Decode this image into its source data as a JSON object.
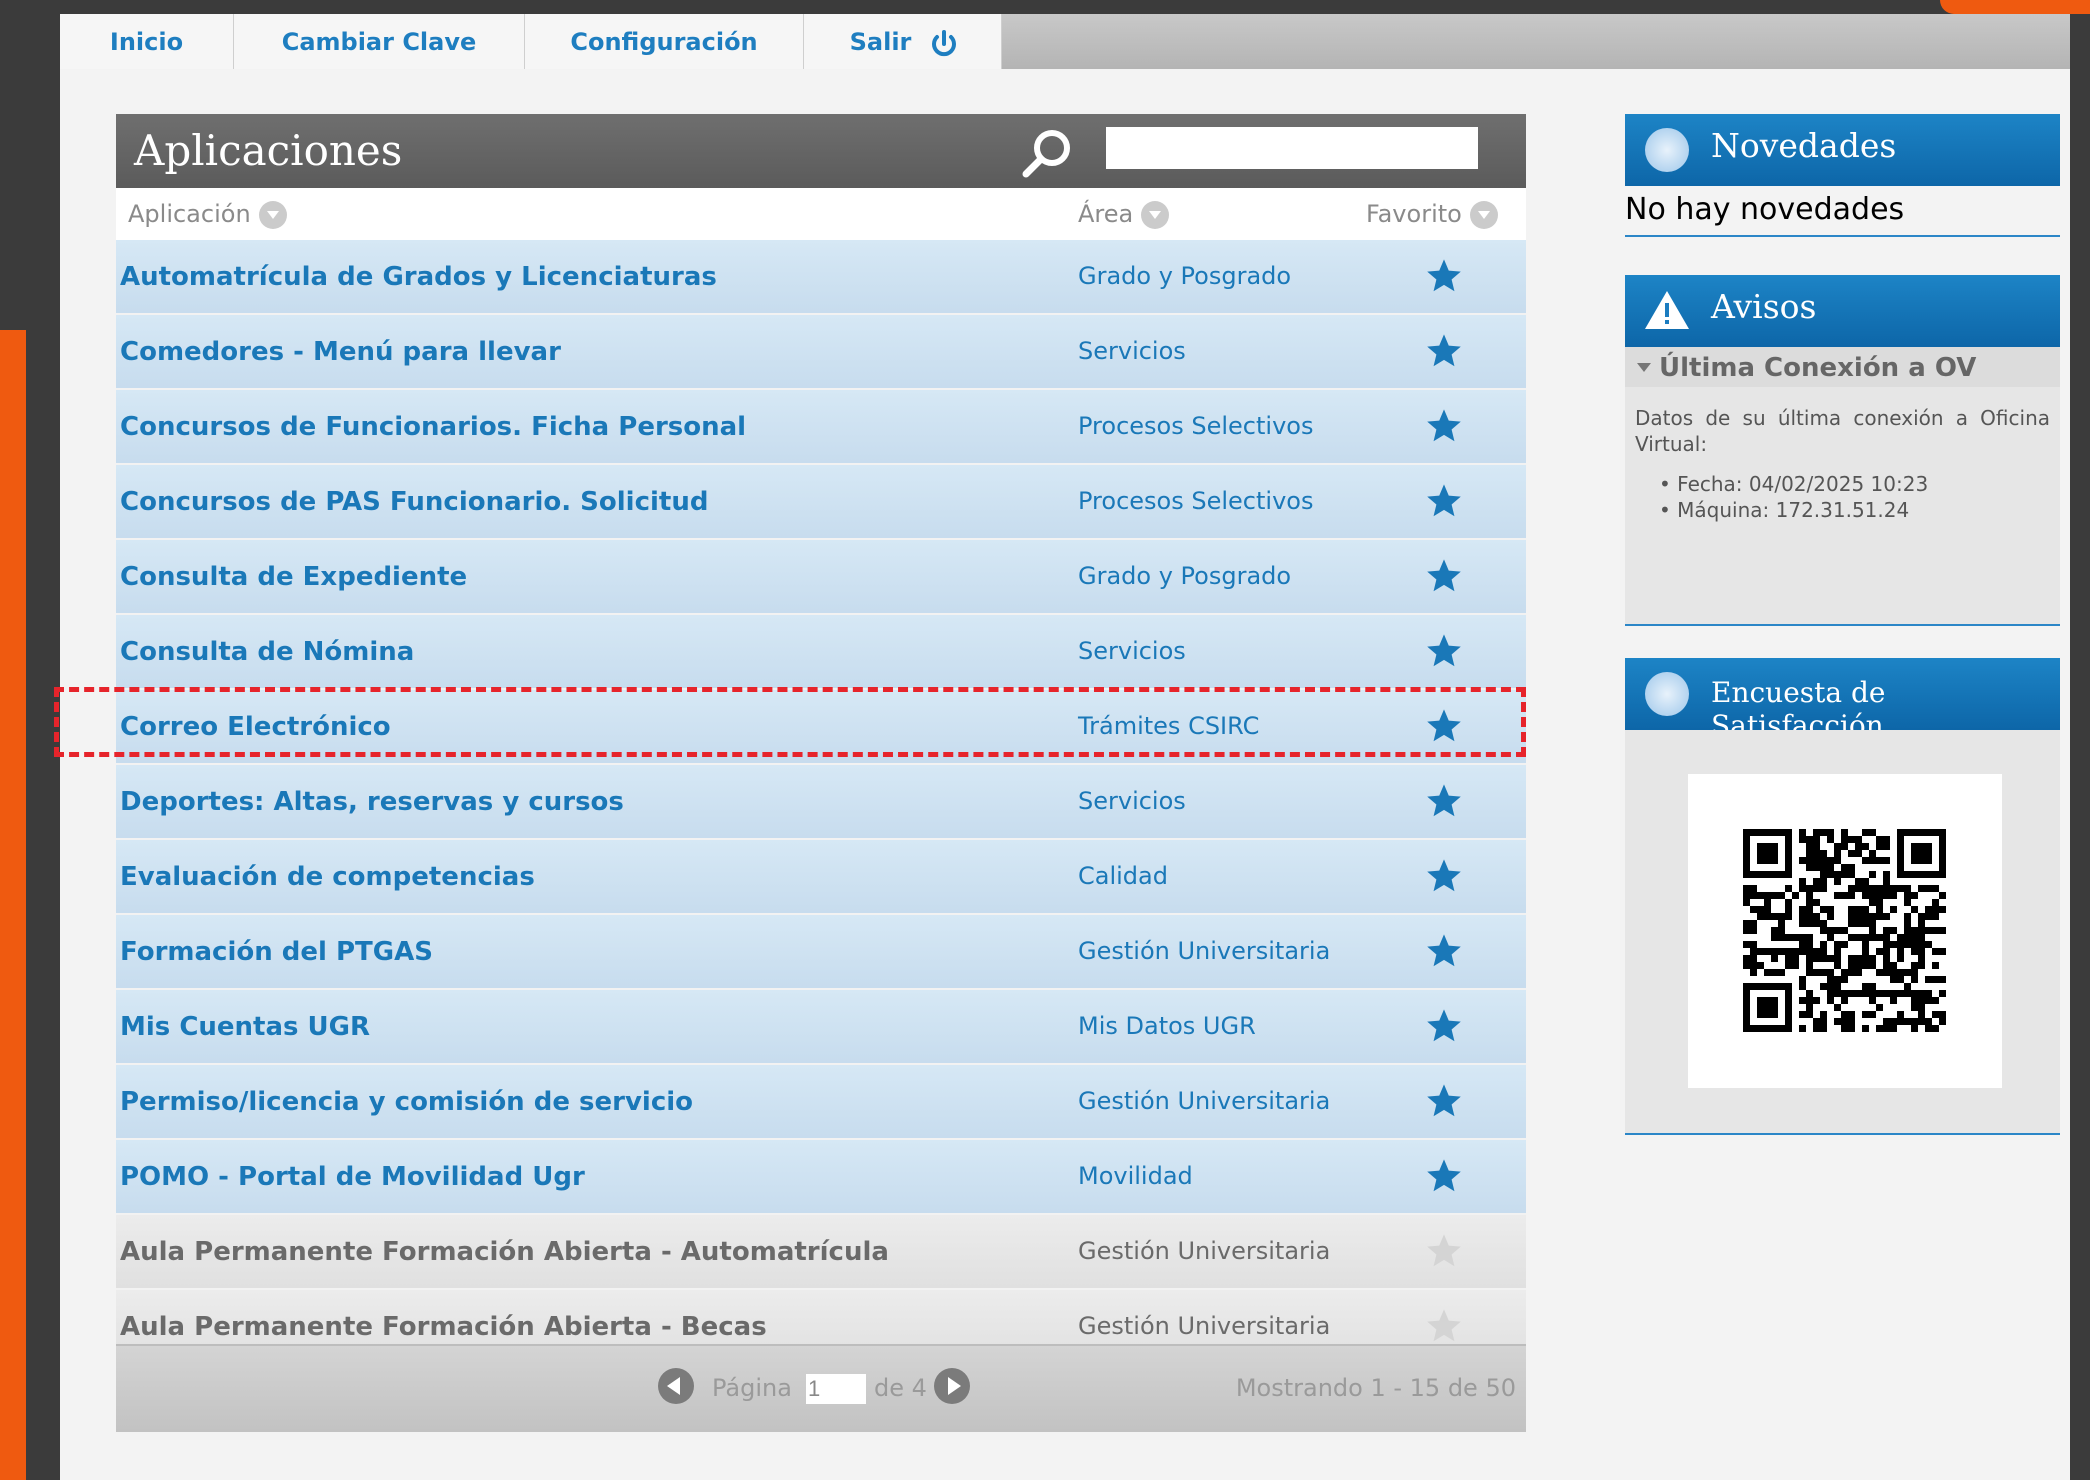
{
  "nav": {
    "tabs": [
      {
        "label": "Inicio"
      },
      {
        "label": "Cambiar Clave"
      },
      {
        "label": "Configuración"
      },
      {
        "label": "Salir"
      }
    ]
  },
  "apps": {
    "title": "Aplicaciones",
    "search_value": "",
    "columns": {
      "app": "Aplicación",
      "area": "Área",
      "fav": "Favorito"
    },
    "rows": [
      {
        "name": "Automatrícula de Grados y Licenciaturas",
        "area": "Grado y Posgrado",
        "favorite": true
      },
      {
        "name": "Comedores - Menú para llevar",
        "area": "Servicios",
        "favorite": true
      },
      {
        "name": "Concursos de Funcionarios. Ficha Personal",
        "area": "Procesos Selectivos",
        "favorite": true
      },
      {
        "name": "Concursos de PAS Funcionario. Solicitud",
        "area": "Procesos Selectivos",
        "favorite": true
      },
      {
        "name": "Consulta de Expediente",
        "area": "Grado y Posgrado",
        "favorite": true
      },
      {
        "name": "Consulta de Nómina",
        "area": "Servicios",
        "favorite": true
      },
      {
        "name": "Correo Electrónico",
        "area": "Trámites CSIRC",
        "favorite": true
      },
      {
        "name": "Deportes: Altas, reservas y cursos",
        "area": "Servicios",
        "favorite": true
      },
      {
        "name": "Evaluación de competencias",
        "area": "Calidad",
        "favorite": true
      },
      {
        "name": "Formación del PTGAS",
        "area": "Gestión Universitaria",
        "favorite": true
      },
      {
        "name": "Mis Cuentas UGR",
        "area": "Mis Datos UGR",
        "favorite": true
      },
      {
        "name": "Permiso/licencia y comisión de servicio",
        "area": "Gestión Universitaria",
        "favorite": true
      },
      {
        "name": "POMO - Portal de Movilidad Ugr",
        "area": "Movilidad",
        "favorite": true
      },
      {
        "name": "Aula Permanente Formación Abierta - Automatrícula",
        "area": "Gestión Universitaria",
        "favorite": false
      },
      {
        "name": "Aula Permanente Formación Abierta - Becas",
        "area": "Gestión Universitaria",
        "favorite": false
      }
    ],
    "pager": {
      "page_label": "Página",
      "page_value": "1",
      "of_label": "de 4",
      "showing": "Mostrando 1 - 15 de 50"
    }
  },
  "side": {
    "novedades": {
      "title": "Novedades",
      "text": "No hay novedades"
    },
    "avisos": {
      "title": "Avisos",
      "section": "Última Conexión a OV",
      "desc": "Datos de su última conexión a Oficina Virtual:",
      "items": [
        "Fecha: 04/02/2025 10:23",
        "Máquina: 172.31.51.24"
      ]
    },
    "encuesta": {
      "title": "Encuesta de Satisfacción"
    }
  },
  "colors": {
    "link": "#1a78b8",
    "header_blue": "#1d84c6",
    "star_active": "#1a78b8",
    "star_inactive": "#d4d4d4",
    "highlight": "#e6242b",
    "accent_orange": "#ef5a10"
  }
}
